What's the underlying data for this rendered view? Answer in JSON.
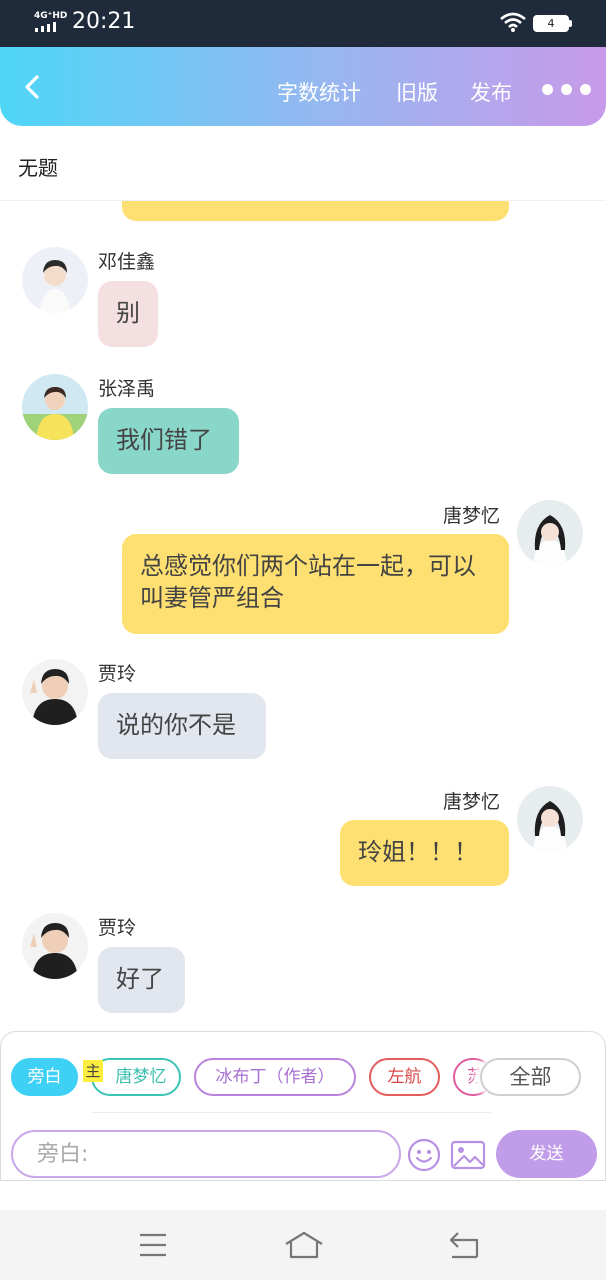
{
  "status_bar": {
    "network": "4G⁺HD",
    "time": "20:21",
    "battery": "4"
  },
  "header": {
    "word_count_label": "字数统计",
    "old_version_label": "旧版",
    "publish_label": "发布",
    "gradient": [
      "#4ed6f7",
      "#98b6f0",
      "#c89ae9"
    ]
  },
  "document": {
    "title": "无题"
  },
  "messages": [
    {
      "sender": "邓佳鑫",
      "text": "别",
      "side": "left",
      "bubble_color": "#f4dfe1"
    },
    {
      "sender": "张泽禹",
      "text": "我们错了",
      "side": "left",
      "bubble_color": "#89d7c9"
    },
    {
      "sender": "唐梦忆",
      "text": "总感觉你们两个站在一起，可以叫妻管严组合",
      "side": "right",
      "bubble_color": "#fde071"
    },
    {
      "sender": "贾玲",
      "text": "说的你不是",
      "side": "left",
      "bubble_color": "#e2e6ee"
    },
    {
      "sender": "唐梦忆",
      "text": "玲姐！！！",
      "side": "right",
      "bubble_color": "#fde071"
    },
    {
      "sender": "贾玲",
      "text": "好了",
      "side": "left",
      "bubble_color": "#e2e6ee"
    }
  ],
  "roles": {
    "narration": "旁白",
    "host_badge": "主",
    "items": [
      "唐梦忆",
      "冰布丁（作者）",
      "左航",
      "苏"
    ],
    "all": "全部"
  },
  "composer": {
    "placeholder": "旁白:",
    "send_label": "发送"
  },
  "colors": {
    "accent_send": "#c09ce9",
    "narration_chip": "#3fd0f5"
  }
}
